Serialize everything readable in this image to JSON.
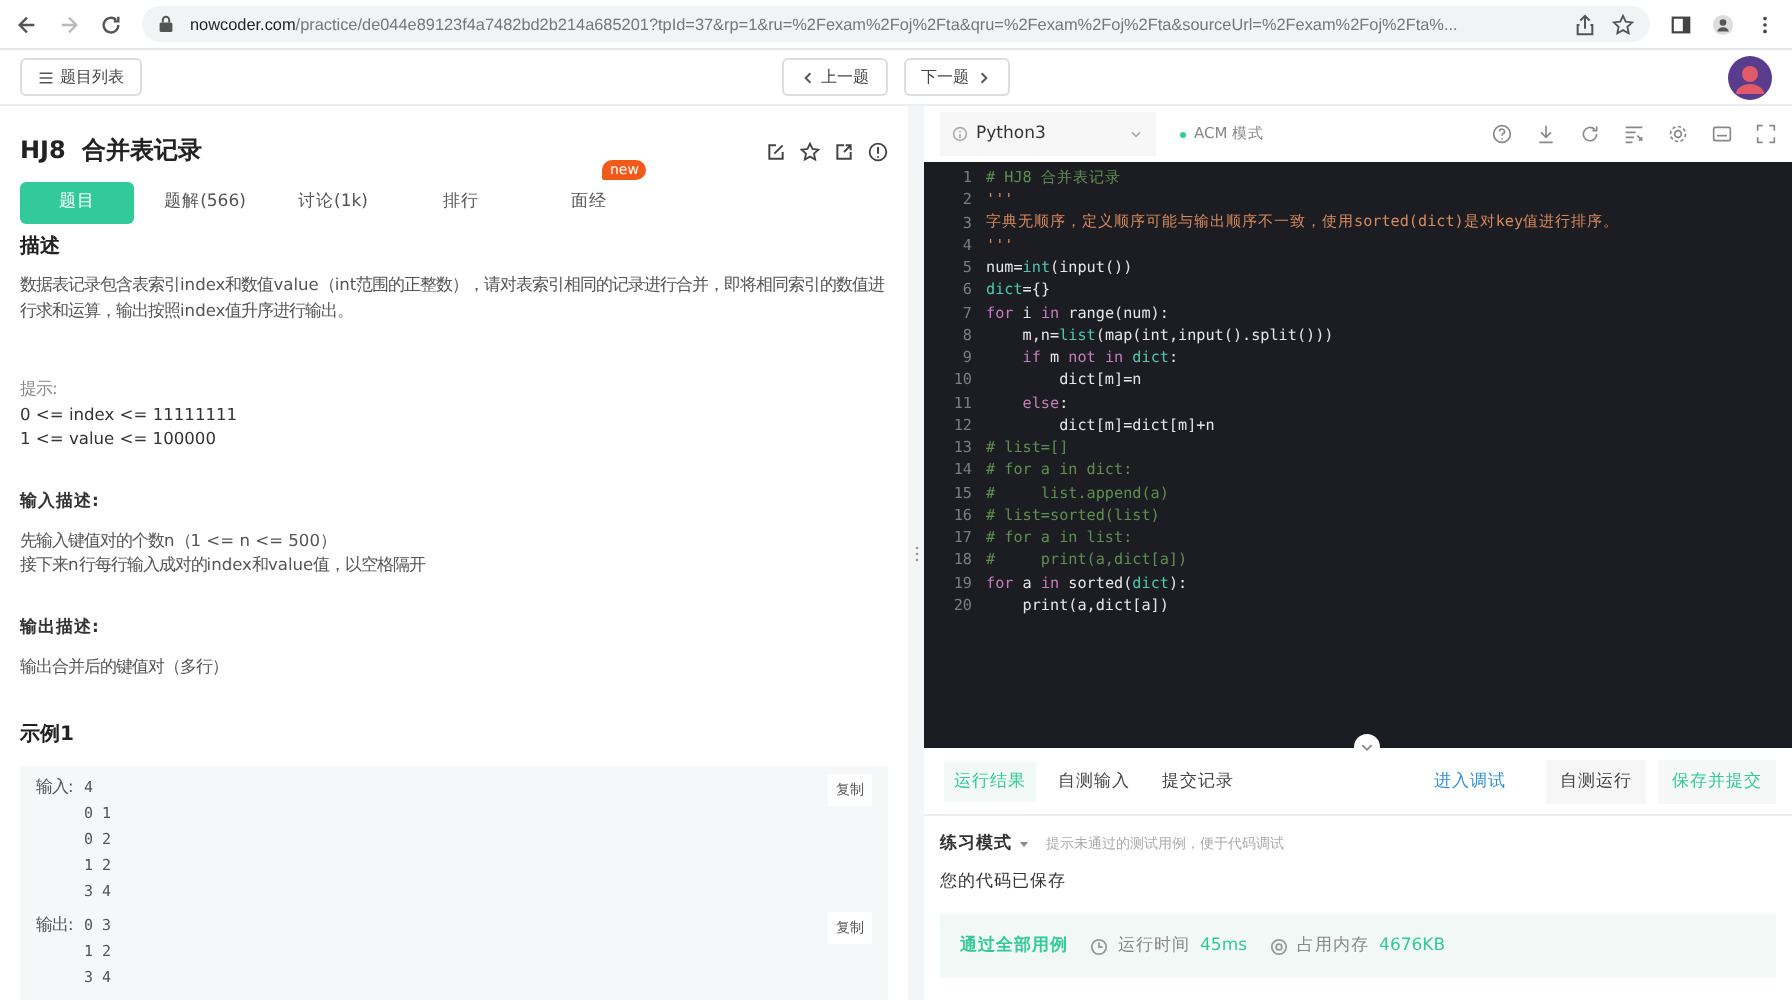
{
  "browser": {
    "url_host": "nowcoder.com",
    "url_path": "/practice/de044e89123f4a7482bd2b214a685201?tpId=37&rp=1&ru=%2Fexam%2Foj%2Fta&qru=%2Fexam%2Foj%2Fta&sourceUrl=%2Fexam%2Foj%2Fta%..."
  },
  "toolbar": {
    "list_button": "题目列表",
    "prev_button": "上一题",
    "next_button": "下一题"
  },
  "problem": {
    "title": "HJ8  合并表记录",
    "tabs": [
      {
        "label": "题目",
        "selected": true
      },
      {
        "label": "题解(566)",
        "selected": false
      },
      {
        "label": "讨论(1k)",
        "selected": false
      },
      {
        "label": "排行",
        "selected": false
      },
      {
        "label": "面经",
        "selected": false,
        "badge": "new"
      }
    ],
    "description_heading": "描述",
    "description": "数据表记录包含表索引index和数值value（int范围的正整数），请对表索引相同的记录进行合并，即将相同索引的数值进行求和运算，输出按照index值升序进行输出。",
    "hint_label": "提示:",
    "hints": [
      "0 <= index <= 11111111",
      "1 <= value <= 100000"
    ],
    "input_heading": "输入描述:",
    "input_lines": [
      "先输入键值对的个数n（1 <= n <= 500）",
      "接下来n行每行输入成对的index和value值，以空格隔开"
    ],
    "output_heading": "输出描述:",
    "output_lines": [
      "输出合并后的键值对（多行）"
    ],
    "example": {
      "title": "示例1",
      "blocks": [
        {
          "label": "输入:",
          "lines": [
            "4",
            "0 1",
            "0 2",
            "1 2",
            "3 4"
          ],
          "copy": "复制"
        },
        {
          "label": "输出:",
          "lines": [
            "0 3",
            "1 2",
            "3 4"
          ],
          "copy": "复制"
        }
      ]
    }
  },
  "editor": {
    "language": "Python3",
    "mode": "ACM 模式",
    "lines": [
      {
        "number": "1",
        "tokens": [
          {
            "kind": "comment",
            "text": "# HJ8 合并表记录"
          }
        ]
      },
      {
        "number": "2",
        "tokens": [
          {
            "kind": "string",
            "text": "'''"
          }
        ]
      },
      {
        "number": "3",
        "tokens": [
          {
            "kind": "string",
            "text": "字典无顺序，定义顺序可能与输出顺序不一致，使用sorted(dict)是对key值进行排序。"
          }
        ]
      },
      {
        "number": "4",
        "tokens": [
          {
            "kind": "string",
            "text": "'''"
          }
        ]
      },
      {
        "number": "5",
        "tokens": [
          {
            "kind": "plain",
            "text": "num="
          },
          {
            "kind": "builtin",
            "text": "int"
          },
          {
            "kind": "plain",
            "text": "(input())"
          }
        ]
      },
      {
        "number": "6",
        "tokens": [
          {
            "kind": "builtin",
            "text": "dict"
          },
          {
            "kind": "plain",
            "text": "={}"
          }
        ]
      },
      {
        "number": "7",
        "tokens": [
          {
            "kind": "keyword",
            "text": "for"
          },
          {
            "kind": "plain",
            "text": " i "
          },
          {
            "kind": "keyword",
            "text": "in"
          },
          {
            "kind": "plain",
            "text": " range(num):"
          }
        ]
      },
      {
        "number": "8",
        "tokens": [
          {
            "kind": "plain",
            "text": "    m,n="
          },
          {
            "kind": "builtin",
            "text": "list"
          },
          {
            "kind": "plain",
            "text": "(map(int,input().split()))"
          }
        ]
      },
      {
        "number": "9",
        "tokens": [
          {
            "kind": "keyword",
            "text": "    if"
          },
          {
            "kind": "plain",
            "text": " m "
          },
          {
            "kind": "keyword",
            "text": "not in "
          },
          {
            "kind": "builtin",
            "text": "dict"
          },
          {
            "kind": "plain",
            "text": ":"
          }
        ]
      },
      {
        "number": "10",
        "tokens": [
          {
            "kind": "plain",
            "text": "        dict[m]=n"
          }
        ]
      },
      {
        "number": "11",
        "tokens": [
          {
            "kind": "keyword",
            "text": "    else"
          },
          {
            "kind": "plain",
            "text": ":"
          }
        ]
      },
      {
        "number": "12",
        "tokens": [
          {
            "kind": "plain",
            "text": "        dict[m]=dict[m]+n"
          }
        ]
      },
      {
        "number": "13",
        "tokens": [
          {
            "kind": "comment",
            "text": "# list=[]"
          }
        ]
      },
      {
        "number": "14",
        "tokens": [
          {
            "kind": "comment",
            "text": "# for a in dict:"
          }
        ]
      },
      {
        "number": "15",
        "tokens": [
          {
            "kind": "comment",
            "text": "#     list.append(a)"
          }
        ]
      },
      {
        "number": "16",
        "tokens": [
          {
            "kind": "comment",
            "text": "# list=sorted(list)"
          }
        ]
      },
      {
        "number": "17",
        "tokens": [
          {
            "kind": "comment",
            "text": "# for a in list:"
          }
        ]
      },
      {
        "number": "18",
        "tokens": [
          {
            "kind": "comment",
            "text": "#     print(a,dict[a])"
          }
        ]
      },
      {
        "number": "19",
        "tokens": [
          {
            "kind": "keyword",
            "text": "for"
          },
          {
            "kind": "plain",
            "text": " a "
          },
          {
            "kind": "keyword",
            "text": "in"
          },
          {
            "kind": "plain",
            "text": " sorted("
          },
          {
            "kind": "builtin",
            "text": "dict"
          },
          {
            "kind": "plain",
            "text": "):"
          }
        ]
      },
      {
        "number": "20",
        "tokens": [
          {
            "kind": "plain",
            "text": "    print(a,dict[a])"
          }
        ]
      }
    ]
  },
  "console": {
    "tabs": [
      {
        "label": "运行结果",
        "selected": true
      },
      {
        "label": "自测输入",
        "selected": false
      },
      {
        "label": "提交记录",
        "selected": false
      }
    ],
    "debug_link": "进入调试",
    "run_button": "自测运行",
    "submit_button": "保存并提交",
    "practice_mode": "练习模式",
    "practice_hint": "提示未通过的测试用例，便于代码调试",
    "saved": "您的代码已保存",
    "result": {
      "status": "通过全部用例",
      "time_label": "运行时间",
      "time": "45ms",
      "memory_label": "占用内存",
      "memory": "4676KB"
    }
  }
}
